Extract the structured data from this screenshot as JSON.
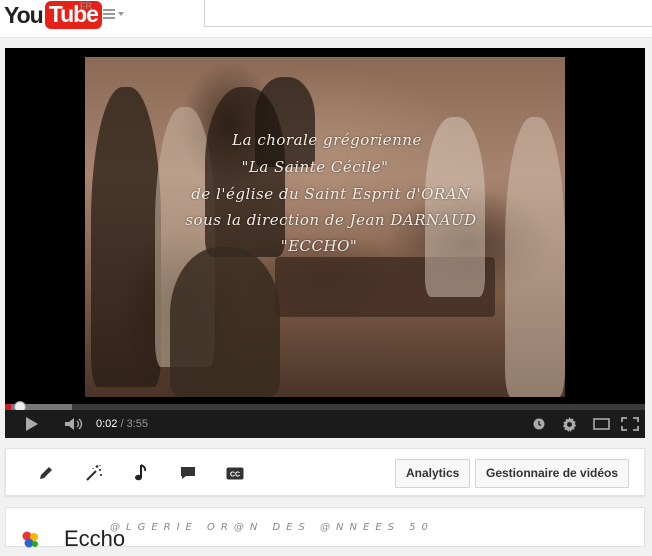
{
  "masthead": {
    "logo_you": "You",
    "logo_tube": "Tube",
    "region": "FR"
  },
  "player": {
    "captions": [
      "La chorale grégorienne",
      "\"La Sainte Cécile\"",
      "de l'église du Saint Esprit d'ORAN",
      "sous la direction de Jean DARNAUD",
      "\"ECCHO\""
    ],
    "progress": {
      "played_fraction": 0.0093,
      "buffered_fraction": 0.105
    },
    "time_current": "0:02",
    "time_separator": " / ",
    "time_total": "3:55",
    "colors": {
      "played": "#cc181e",
      "controls_bg": "#1b1b1b"
    }
  },
  "actions": {
    "tools": [
      "pencil-icon",
      "magic-wand-icon",
      "music-note-icon",
      "comment-icon",
      "cc-icon"
    ],
    "analytics_label": "Analytics",
    "video_manager_label": "Gestionnaire de vidéos"
  },
  "channel": {
    "title": "Eccho",
    "tagline": "@LGERIE OR@N DES @NNEES 50"
  }
}
